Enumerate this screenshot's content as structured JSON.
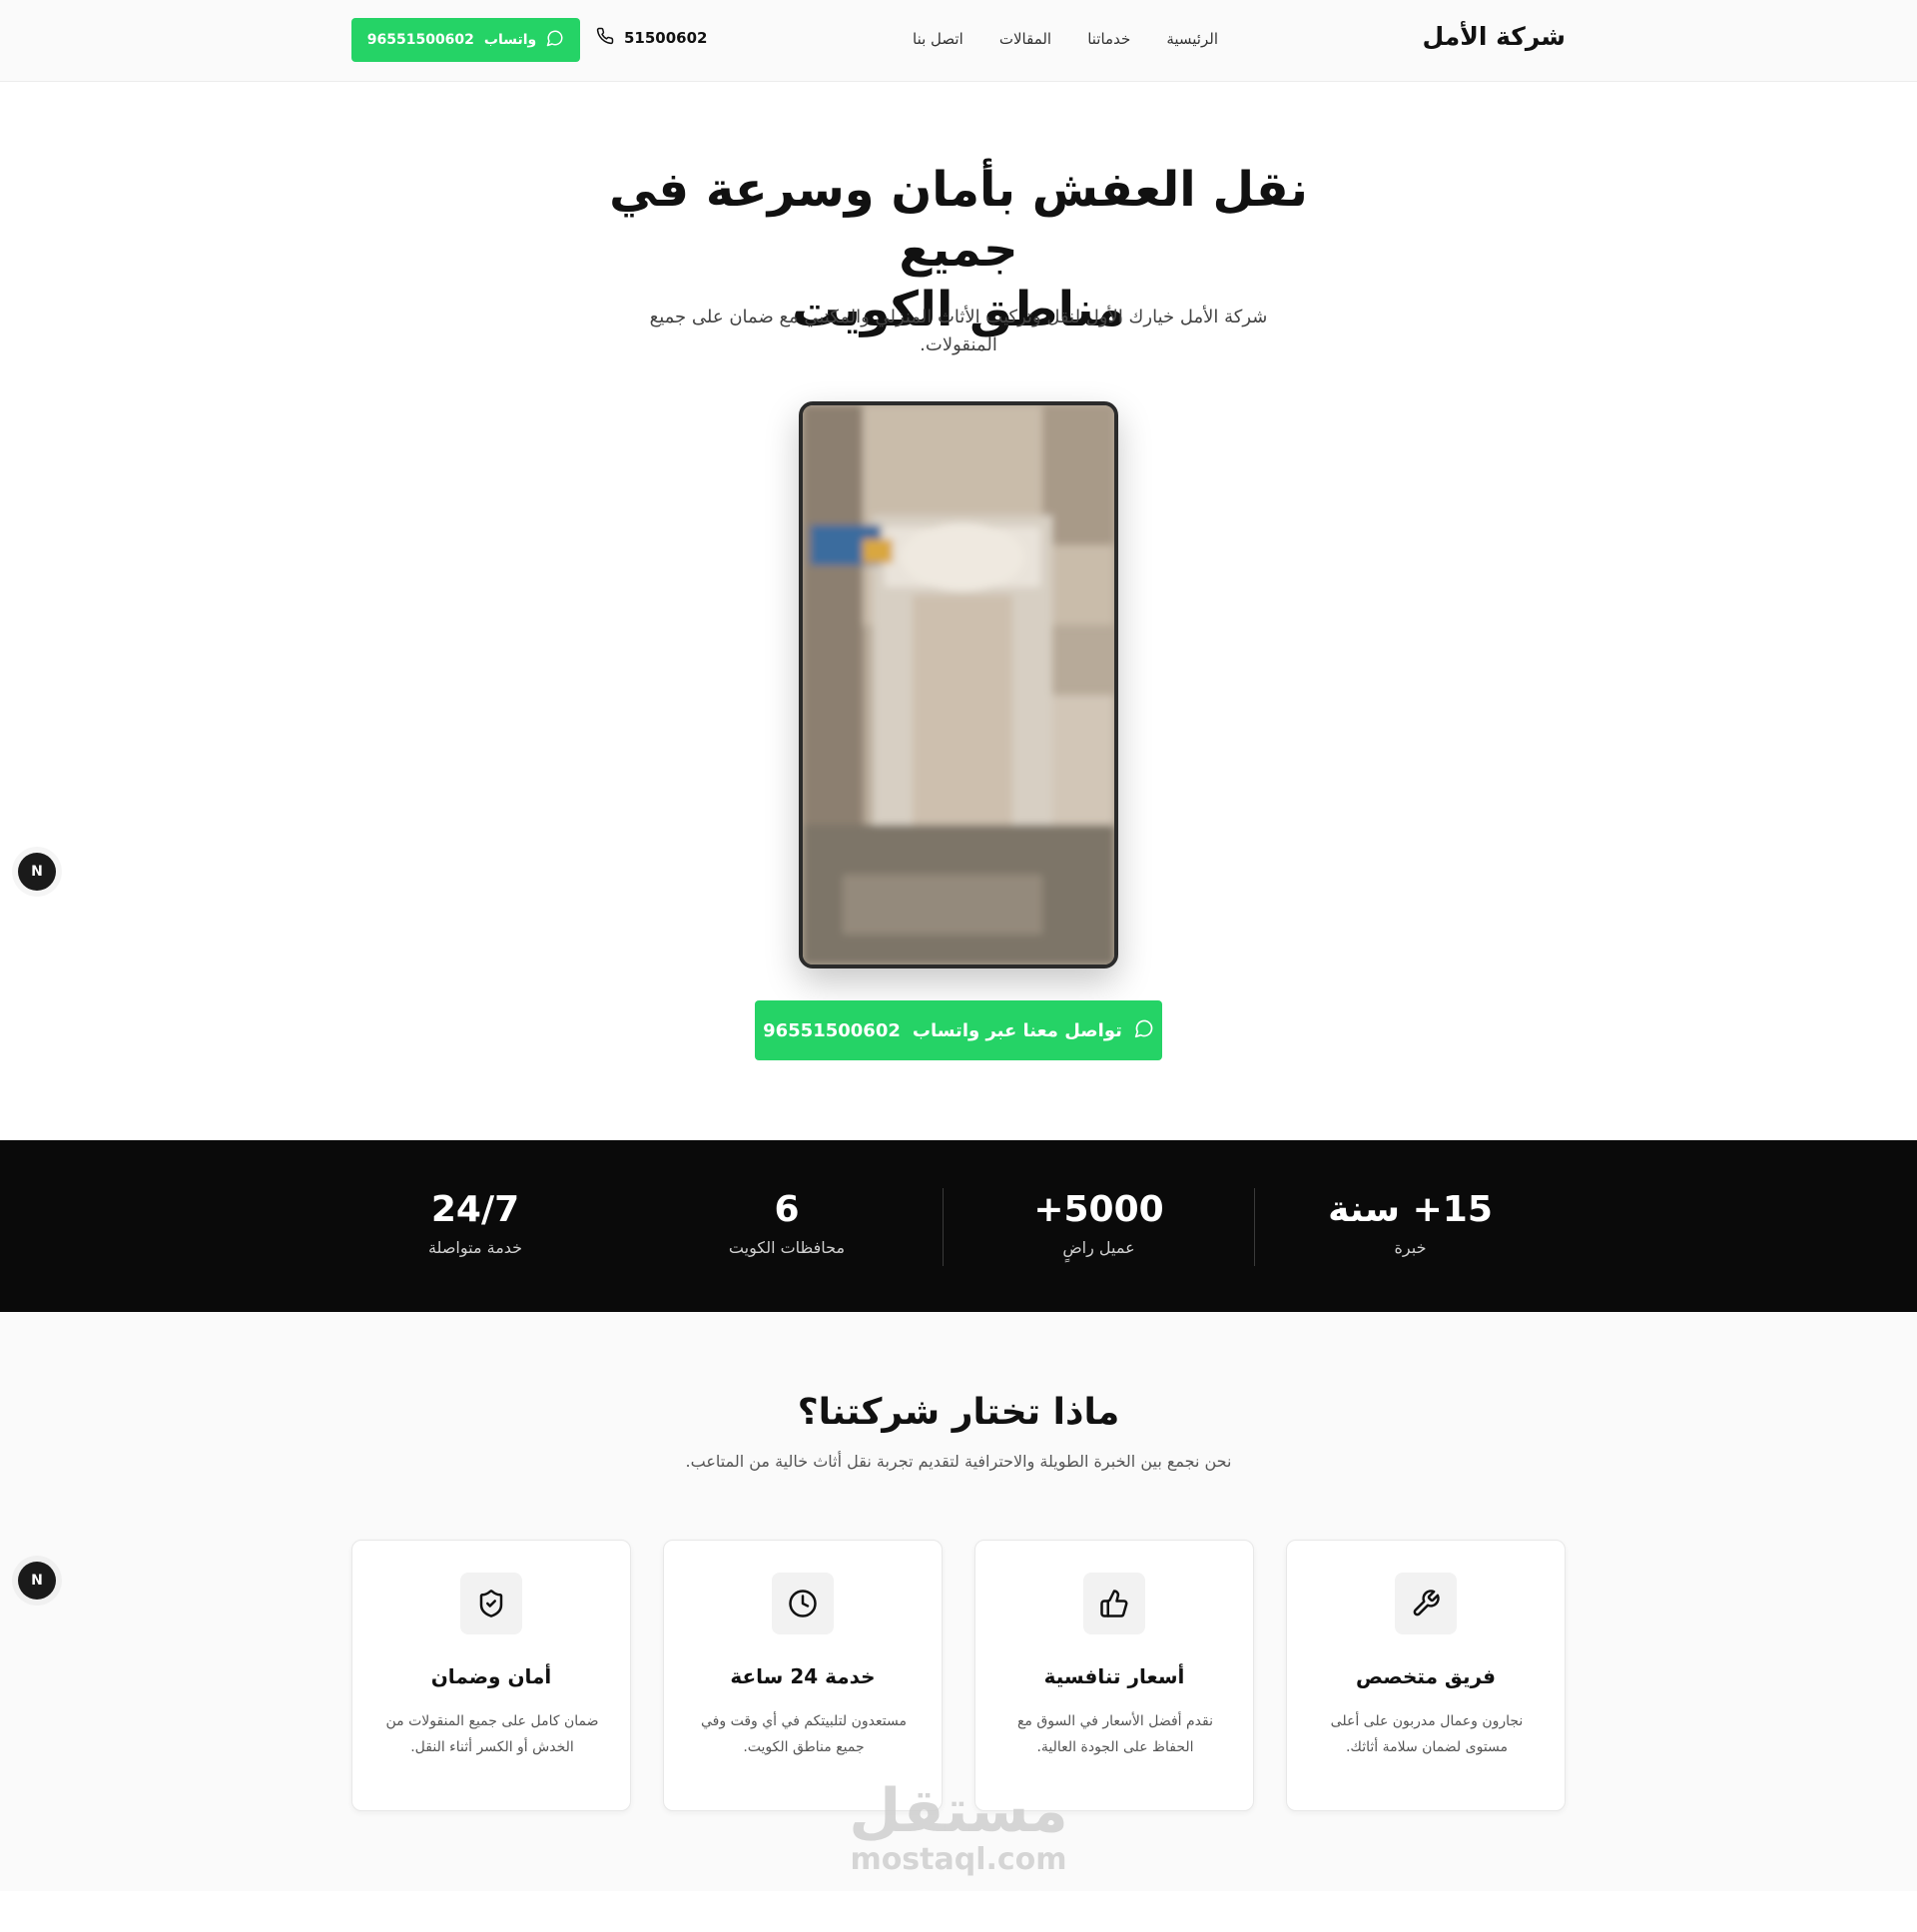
{
  "header": {
    "brand": "شركة الأمل",
    "nav": [
      "الرئيسية",
      "خدماتنا",
      "المقالات",
      "اتصل بنا"
    ],
    "phone": "51500602",
    "whatsapp_label": "واتساب",
    "whatsapp_number": "96551500602"
  },
  "hero": {
    "title_line1": "نقل العفش بأمان وسرعة في جميع",
    "title_line2": "مناطق الكويت",
    "subtitle_line1": "شركة الأمل خيارك الأول لنقل وتركيب الأثاث المنزلي والمكتبي مع ضمان على جميع",
    "subtitle_line2": "المنقولات.",
    "cta_label": "تواصل معنا عبر واتساب",
    "cta_number": "96551500602"
  },
  "stats": [
    {
      "value": "15+ سنة",
      "label": "خبرة"
    },
    {
      "value": "5000+",
      "label": "عميل راضٍ"
    },
    {
      "value": "6",
      "label": "محافظات الكويت"
    },
    {
      "value": "24/7",
      "label": "خدمة متواصلة"
    }
  ],
  "why": {
    "title": "ماذا تختار شركتنا؟",
    "subtitle": "نحن نجمع بين الخبرة الطويلة والاحترافية لتقديم تجربة نقل أثاث خالية من المتاعب.",
    "cards": [
      {
        "icon": "wrench-icon",
        "title": "فريق متخصص",
        "desc": "نجارون وعمال مدربون على أعلى مستوى لضمان سلامة أثاثك."
      },
      {
        "icon": "thumbs-up-icon",
        "title": "أسعار تنافسية",
        "desc": "نقدم أفضل الأسعار في السوق مع الحفاظ على الجودة العالية."
      },
      {
        "icon": "clock-icon",
        "title": "خدمة 24 ساعة",
        "desc": "مستعدون لتلبيتكم في أي وقت وفي جميع مناطق الكويت."
      },
      {
        "icon": "shield-check-icon",
        "title": "أمان وضمان",
        "desc": "ضمان كامل على جميع المنقولات من الخدش أو الكسر أثناء النقل."
      }
    ]
  },
  "floating": {
    "badge": "N"
  },
  "watermark": {
    "arabic": "مستقل",
    "latin": "mostaql.com"
  },
  "colors": {
    "accent": "#25d366",
    "dark": "#0a0a0a",
    "text": "#111111"
  }
}
